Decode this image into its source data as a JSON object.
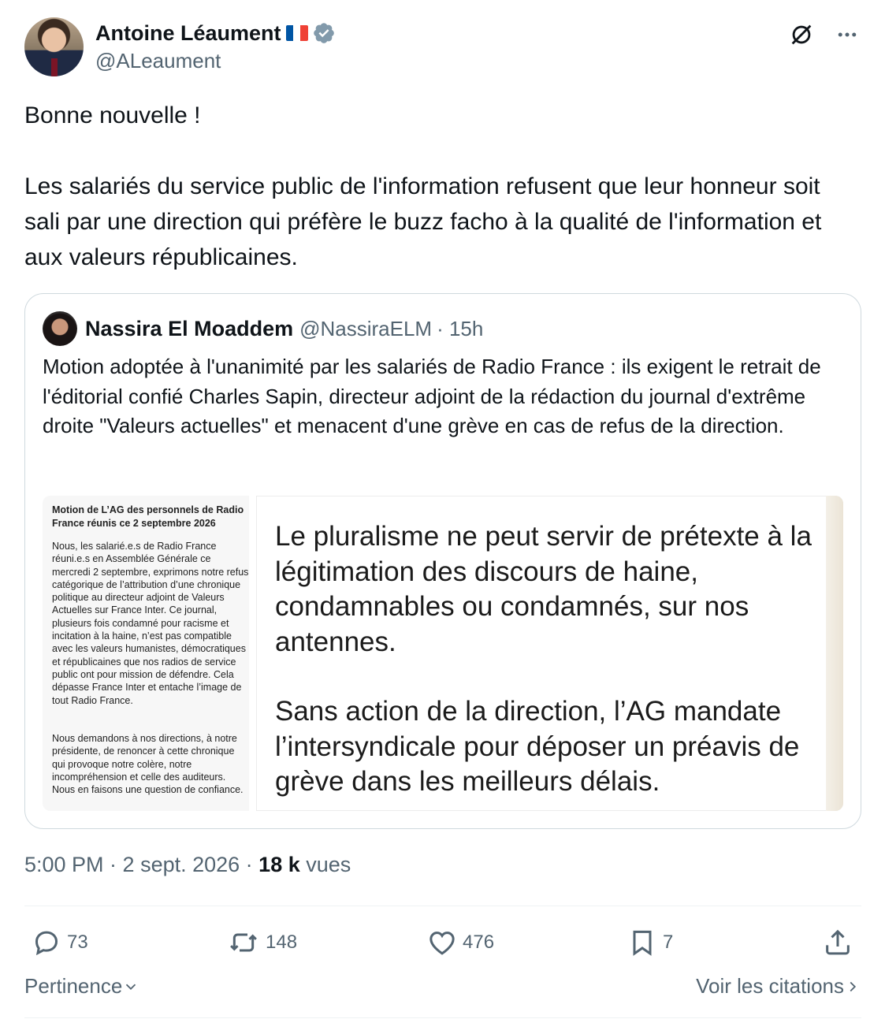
{
  "author": {
    "display_name": "Antoine Léaument",
    "handle": "@ALeaument",
    "flag_colors": [
      "#0055a4",
      "#ffffff",
      "#ef4135"
    ],
    "verified_color": "#829aab"
  },
  "header_icons": [
    "grok-icon",
    "more-icon"
  ],
  "post": {
    "text": "Bonne nouvelle !\n\nLes salariés du service public de l'information refusent que leur honneur soit sali par une direction qui préfère le buzz facho à la qualité de l'information et aux valeurs républicaines."
  },
  "quoted": {
    "display_name": "Nassira El Moaddem",
    "handle": "@NassiraELM",
    "time": "· 15h",
    "text": "Motion adoptée à l'unanimité par les salariés de Radio France : ils exigent le retrait de l'éditorial confié Charles Sapin, directeur adjoint de la rédaction du journal d'extrême droite \"Valeurs actuelles\" et menacent d'une grève en cas de refus de la direction.",
    "image_left": {
      "title": "Motion de L’AG des personnels de Radio France réunis ce 2 septembre 2026",
      "para1": "Nous, les salarié.e.s de Radio France réuni.e.s en Assemblée Générale ce mercredi 2 septembre, exprimons notre refus catégorique de l’attribution d’une chronique politique au directeur adjoint de Valeurs Actuelles sur France Inter. Ce journal, plusieurs fois condamné pour racisme et incitation à la haine, n’est pas compatible avec les valeurs humanistes, démocratiques et républicaines que nos radios de service public ont pour mission de défendre. Cela dépasse France Inter et entache l’image de tout Radio France.",
      "para2": "Nous demandons à nos directions, à notre présidente, de renoncer à cette chronique qui provoque notre colère, notre incompréhension et celle des auditeurs. Nous en faisons une question de confiance."
    },
    "image_right": {
      "para1": "Le pluralisme ne peut servir de prétexte à la légitimation des discours de haine, condamnables ou condamnés, sur nos antennes.",
      "para2": "Sans action de la direction, l’AG mandate l’intersyndicale pour déposer un préavis de grève dans les meilleurs délais."
    }
  },
  "meta": {
    "time_date": "5:00 PM · 2 sept. 2026 · ",
    "views_count": "18 k",
    "views_label": " vues"
  },
  "actions": {
    "replies": "73",
    "reposts": "148",
    "likes": "476",
    "bookmarks": "7"
  },
  "footer": {
    "sort_label": "Pertinence",
    "quotes_label": "Voir les citations"
  }
}
